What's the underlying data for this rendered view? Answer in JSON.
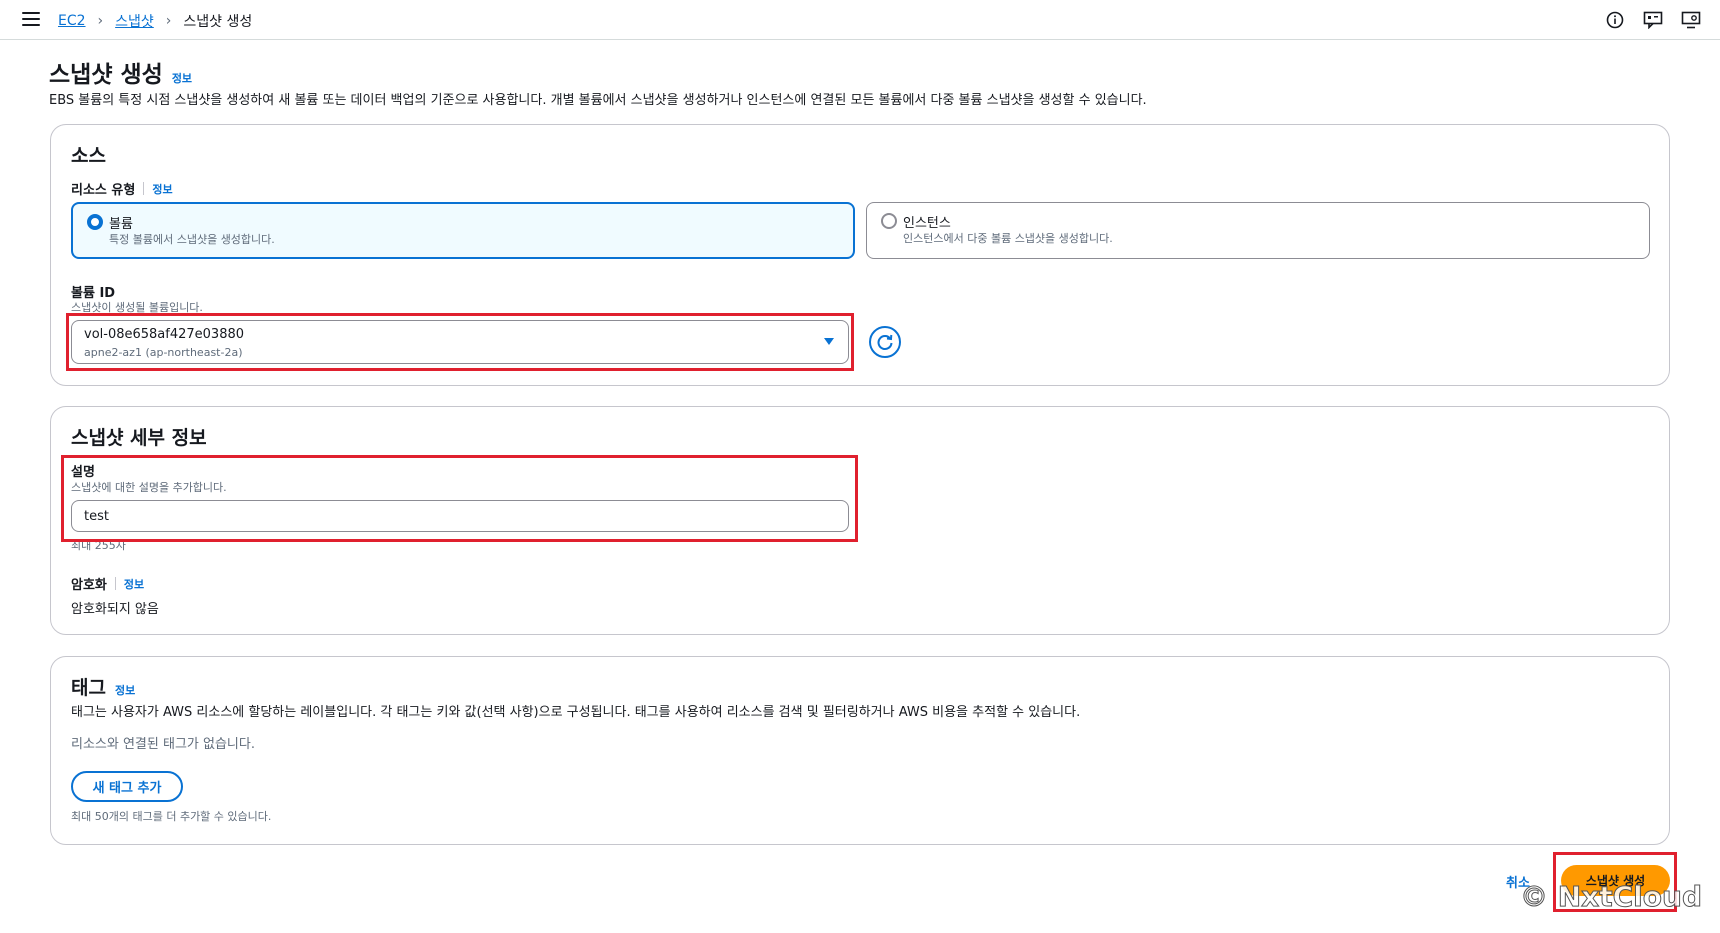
{
  "breadcrumb": {
    "root": "EC2",
    "section": "스냅샷",
    "current": "스냅샷 생성"
  },
  "header": {
    "title": "스냅샷 생성",
    "info": "정보",
    "description": "EBS 볼륨의 특정 시점 스냅샷을 생성하여 새 볼륨 또는 데이터 백업의 기준으로 사용합니다. 개별 볼륨에서 스냅샷을 생성하거나 인스턴스에 연결된 모든 볼륨에서 다중 볼륨 스냅샷을 생성할 수 있습니다."
  },
  "source": {
    "title": "소스",
    "resource_type_label": "리소스 유형",
    "info": "정보",
    "options": [
      {
        "label": "볼륨",
        "description": "특정 볼륨에서 스냅샷을 생성합니다.",
        "selected": true
      },
      {
        "label": "인스턴스",
        "description": "인스턴스에서 다중 볼륨 스냅샷을 생성합니다.",
        "selected": false
      }
    ],
    "volume_id_label": "볼륨 ID",
    "volume_id_desc": "스냅샷이 생성될 볼륨입니다.",
    "volume_id_value": "vol-08e658af427e03880",
    "volume_id_az": "apne2-az1 (ap-northeast-2a)"
  },
  "details": {
    "title": "스냅샷 세부 정보",
    "description_label": "설명",
    "description_hint": "스냅샷에 대한 설명을 추가합니다.",
    "description_value": "test",
    "counter": "최대 255자",
    "encryption_label": "암호화",
    "info": "정보",
    "encryption_value": "암호화되지 않음"
  },
  "tags": {
    "title": "태그",
    "info": "정보",
    "description": "태그는 사용자가 AWS 리소스에 할당하는 레이블입니다. 각 태그는 키와 값(선택 사항)으로 구성됩니다. 태그를 사용하여 리소스를 검색 및 필터링하거나 AWS 비용을 추적할 수 있습니다.",
    "empty": "리소스와 연결된 태그가 없습니다.",
    "add_button": "새 태그 추가",
    "limit": "최대 50개의 태그를 더 추가할 수 있습니다."
  },
  "actions": {
    "cancel": "취소",
    "create": "스냅샷 생성"
  },
  "watermark": "© NxtCloud",
  "colors": {
    "accent": "#0972d3",
    "primary": "#ff9900",
    "highlight": "#e0202e"
  }
}
